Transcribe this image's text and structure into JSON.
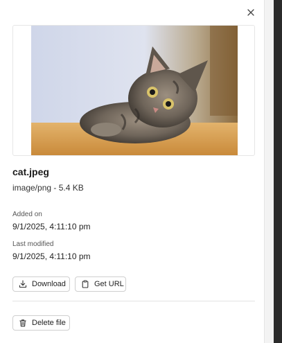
{
  "file": {
    "name": "cat.jpeg",
    "meta": "image/png - 5.4 KB"
  },
  "details": {
    "added_label": "Added on",
    "added_value": "9/1/2025, 4:11:10 pm",
    "modified_label": "Last modified",
    "modified_value": "9/1/2025, 4:11:10 pm"
  },
  "actions": {
    "download_label": "Download",
    "get_url_label": "Get URL",
    "delete_label": "Delete file"
  },
  "icons": {
    "close": "close-icon",
    "download": "download-icon",
    "clipboard": "clipboard-icon",
    "trash": "trash-icon"
  }
}
